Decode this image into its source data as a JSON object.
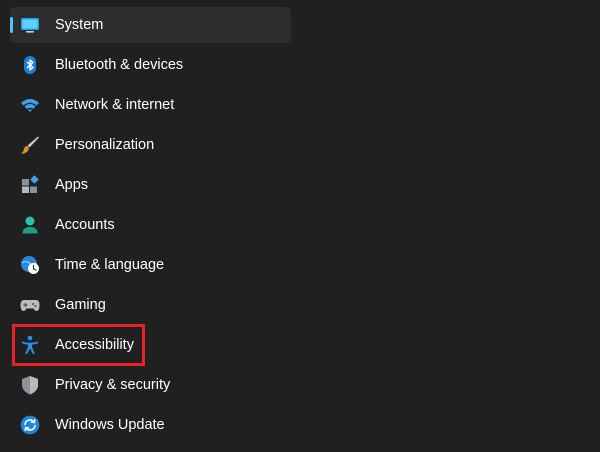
{
  "nav": {
    "items": [
      {
        "label": "System",
        "icon": "system-icon",
        "selected": true
      },
      {
        "label": "Bluetooth & devices",
        "icon": "bluetooth-icon"
      },
      {
        "label": "Network & internet",
        "icon": "wifi-icon"
      },
      {
        "label": "Personalization",
        "icon": "brush-icon"
      },
      {
        "label": "Apps",
        "icon": "apps-icon"
      },
      {
        "label": "Accounts",
        "icon": "person-icon"
      },
      {
        "label": "Time & language",
        "icon": "clock-globe-icon"
      },
      {
        "label": "Gaming",
        "icon": "gamepad-icon"
      },
      {
        "label": "Accessibility",
        "icon": "accessibility-icon",
        "highlighted": true
      },
      {
        "label": "Privacy & security",
        "icon": "shield-icon"
      },
      {
        "label": "Windows Update",
        "icon": "sync-icon"
      }
    ]
  },
  "colors": {
    "background": "#202020",
    "selected_background": "#2d2d2d",
    "accent": "#4cc2ff",
    "highlight_border": "#e8222b",
    "text": "#ffffff"
  }
}
